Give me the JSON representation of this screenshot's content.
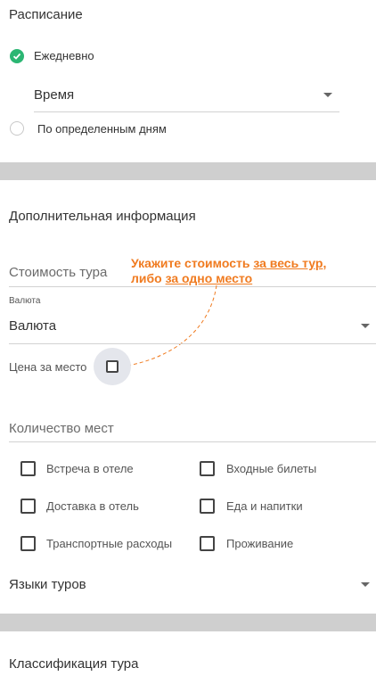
{
  "schedule": {
    "title": "Расписание",
    "options": [
      {
        "label": "Ежедневно",
        "checked": true
      },
      {
        "label": "По определенным дням",
        "checked": false
      }
    ],
    "time_select": {
      "value": "Время"
    }
  },
  "additional": {
    "title": "Дополнительная информация",
    "price_field": {
      "placeholder": "Стоимость тура"
    },
    "hint": {
      "prefix": "Укажите стоимость ",
      "link1": "за весь тур",
      "middle": ",",
      "line2_prefix": "либо ",
      "link2": "за одно место"
    },
    "currency": {
      "label": "Валюта",
      "value": "Валюта"
    },
    "per_seat": {
      "label": "Цена за место",
      "checked": false
    },
    "seats_field": {
      "placeholder": "Количество мест"
    },
    "included": [
      {
        "label": "Встреча в отеле",
        "checked": false
      },
      {
        "label": "Входные билеты",
        "checked": false
      },
      {
        "label": "Доставка в отель",
        "checked": false
      },
      {
        "label": "Еда и напитки",
        "checked": false
      },
      {
        "label": "Транспортные расходы",
        "checked": false
      },
      {
        "label": "Проживание",
        "checked": false
      }
    ],
    "languages": {
      "value": "Языки туров"
    }
  },
  "classification": {
    "title": "Классификация тура"
  },
  "colors": {
    "accent_green": "#2bb673",
    "hint_orange": "#f07b20",
    "divider_gray": "#cfcfcf"
  }
}
